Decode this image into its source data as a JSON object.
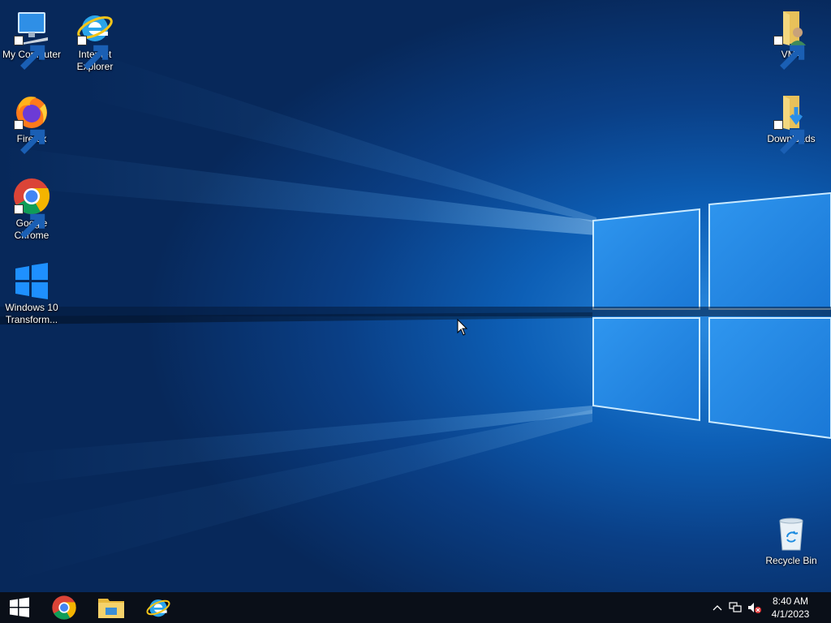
{
  "desktop": {
    "icons_left": [
      {
        "label": "My Computer",
        "icon": "computer-icon"
      },
      {
        "label": "Internet Explorer",
        "icon": "internet-explorer-icon"
      },
      {
        "label": "Firefox",
        "icon": "firefox-icon"
      },
      {
        "label": "Google Chrome",
        "icon": "chrome-icon"
      },
      {
        "label": "Windows 10 Transform...",
        "icon": "windows-logo-icon"
      }
    ],
    "icons_right": [
      {
        "label": "VM4",
        "icon": "user-folder-icon"
      },
      {
        "label": "Downloads",
        "icon": "downloads-folder-icon"
      },
      {
        "label": "Recycle Bin",
        "icon": "recycle-bin-icon"
      }
    ]
  },
  "taskbar": {
    "pinned": [
      {
        "name": "start-button",
        "icon": "windows-start-icon"
      },
      {
        "name": "chrome",
        "icon": "chrome-icon"
      },
      {
        "name": "file-explorer",
        "icon": "file-explorer-icon"
      },
      {
        "name": "internet-explorer",
        "icon": "internet-explorer-icon"
      }
    ],
    "tray": {
      "icons": [
        "chevron-up-icon",
        "network-icon",
        "volume-muted-icon"
      ],
      "time": "8:40 AM",
      "date": "4/1/2023"
    }
  },
  "colors": {
    "taskbar_bg": "#0a0f18",
    "accent": "#0078d7"
  }
}
